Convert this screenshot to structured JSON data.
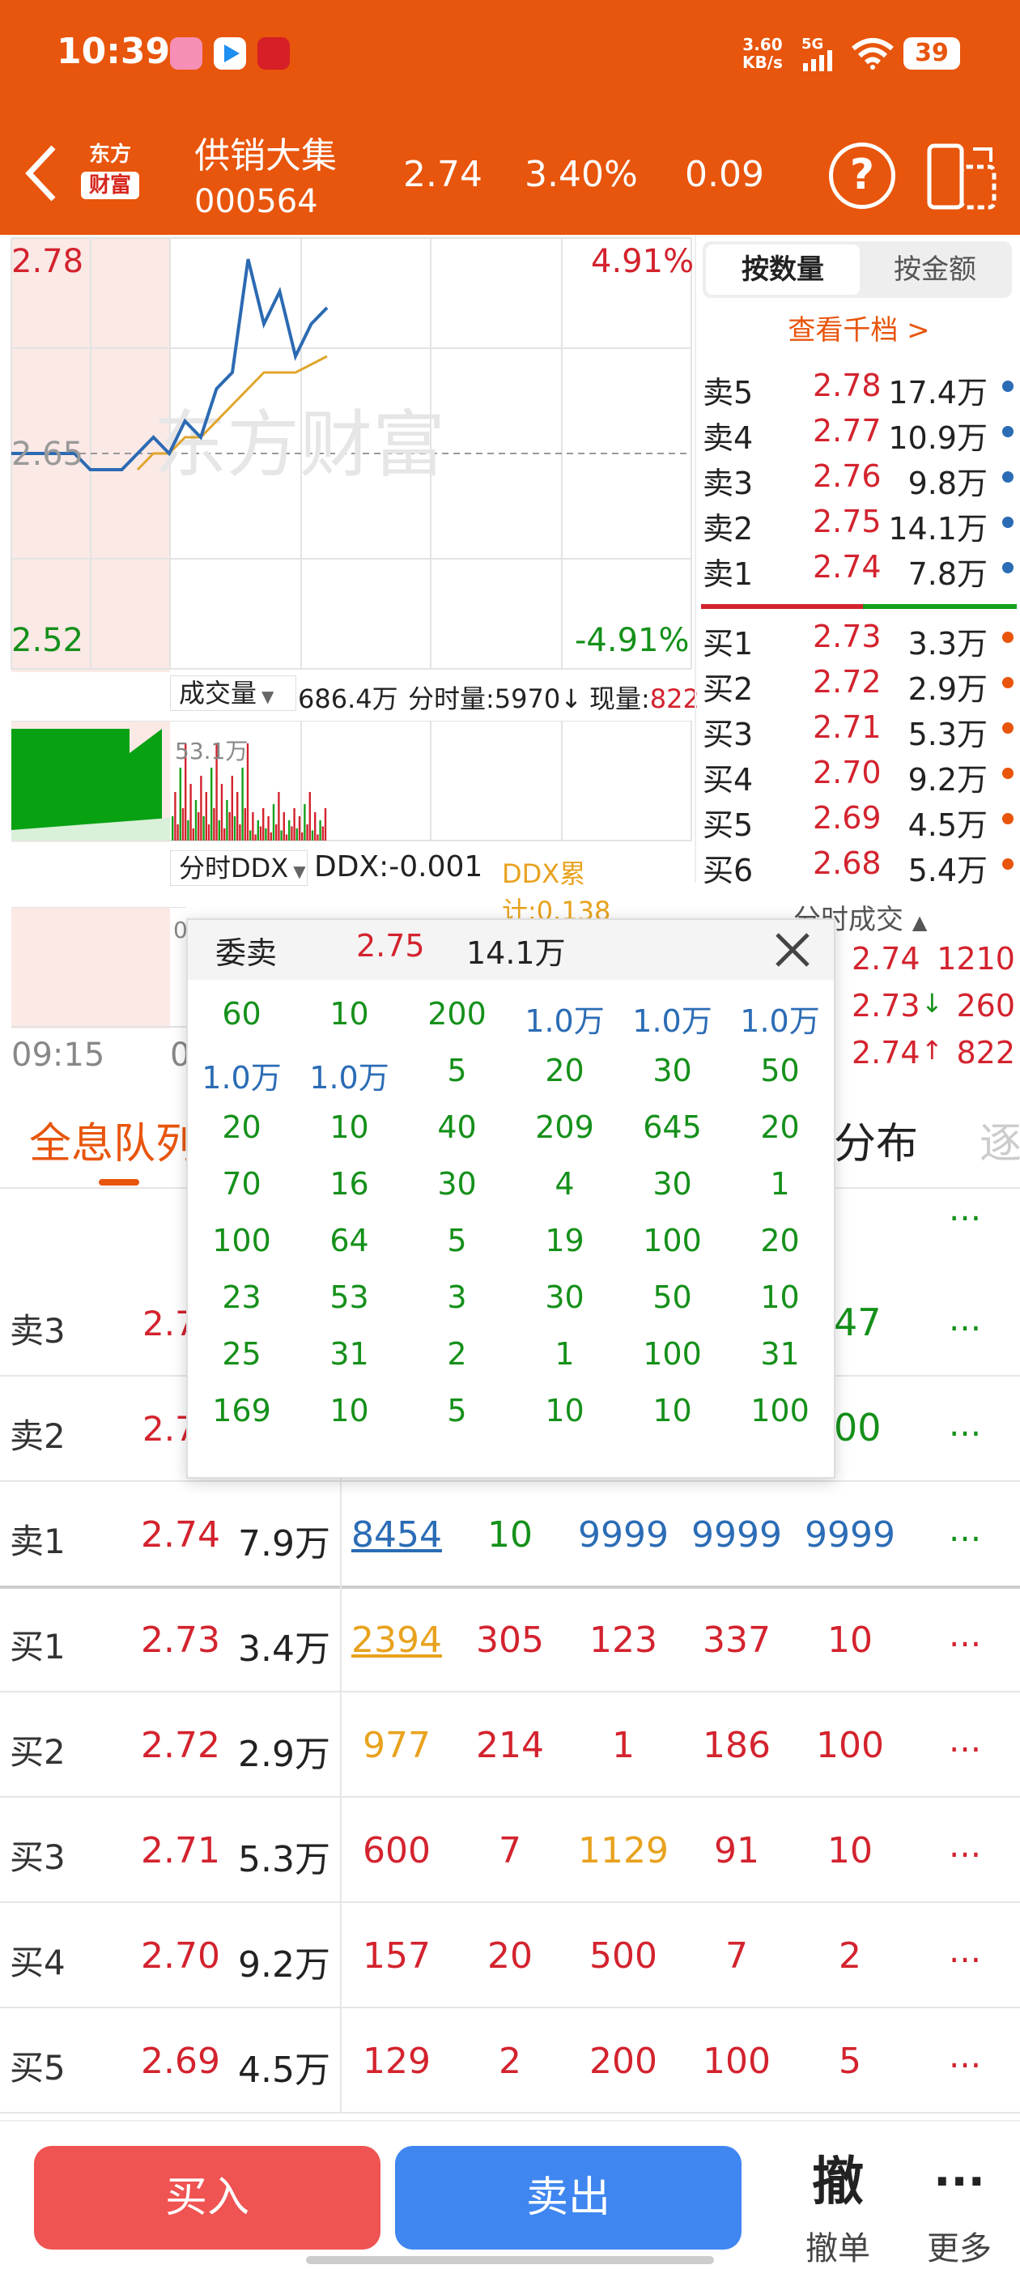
{
  "status": {
    "time": "10:39",
    "speed_value": "3.60",
    "speed_unit": "KB/s",
    "signal": "5G",
    "battery": "39"
  },
  "header": {
    "logo_line1": "东方",
    "logo_line2": "财富",
    "stock_name": "供销大集",
    "stock_code": "000564",
    "price": "2.74",
    "change_pct": "3.40%",
    "change": "0.09"
  },
  "chart": {
    "price_high": "2.78",
    "price_mid": "2.65",
    "price_low": "2.52",
    "pct_high": "4.91%",
    "pct_low": "-4.91%",
    "watermark": "东方财富",
    "volume_selector": "成交量",
    "volume_total": "686.4万",
    "fenshi_label": "分时量:5970",
    "xianliang_label": "现量:",
    "xianliang_value": "822",
    "vol_max": "53.1万",
    "ddx_selector": "分时DDX",
    "ddx_value": "DDX:-0.001",
    "ddx_total": "DDX累计:0.138",
    "time_start": "09:15",
    "time_partial": "0",
    "ddx_axis_partial": "0"
  },
  "chart_data": {
    "type": "line",
    "x": [
      0,
      1,
      2,
      3,
      4,
      5,
      6,
      7,
      8,
      9,
      10,
      11,
      12,
      13,
      14,
      15,
      16,
      17,
      18,
      19,
      20
    ],
    "series": [
      {
        "values": [
          2.65,
          2.65,
          2.65,
          2.65,
          2.65,
          2.64,
          2.64,
          2.64,
          2.65,
          2.66,
          2.65,
          2.67,
          2.66,
          2.69,
          2.7,
          2.77,
          2.73,
          2.75,
          2.71,
          2.73,
          2.74
        ]
      },
      {
        "values": [
          null,
          null,
          null,
          null,
          null,
          null,
          null,
          null,
          2.64,
          2.65,
          2.65,
          2.66,
          2.66,
          2.67,
          2.68,
          2.69,
          2.7,
          2.7,
          2.7,
          2.705,
          2.71
        ]
      }
    ],
    "ylim": [
      2.52,
      2.78
    ],
    "ref_line": 2.65
  },
  "order_book": {
    "tab_quantity": "按数量",
    "tab_amount": "按金额",
    "view_levels": "查看千档 >",
    "sells": [
      {
        "label": "卖5",
        "price": "2.78",
        "qty": "17.4万"
      },
      {
        "label": "卖4",
        "price": "2.77",
        "qty": "10.9万"
      },
      {
        "label": "卖3",
        "price": "2.76",
        "qty": "9.8万"
      },
      {
        "label": "卖2",
        "price": "2.75",
        "qty": "14.1万"
      },
      {
        "label": "卖1",
        "price": "2.74",
        "qty": "7.8万"
      }
    ],
    "buys": [
      {
        "label": "买1",
        "price": "2.73",
        "qty": "3.3万"
      },
      {
        "label": "买2",
        "price": "2.72",
        "qty": "2.9万"
      },
      {
        "label": "买3",
        "price": "2.71",
        "qty": "5.3万"
      },
      {
        "label": "买4",
        "price": "2.70",
        "qty": "9.2万"
      },
      {
        "label": "买5",
        "price": "2.69",
        "qty": "4.5万"
      },
      {
        "label": "买6",
        "price": "2.68",
        "qty": "5.4万"
      }
    ]
  },
  "trades": {
    "title": "分时成交",
    "rows": [
      {
        "price": "2.74",
        "vol": "1210",
        "arrow": ""
      },
      {
        "price": "2.73",
        "vol": "260",
        "arrow": "↓"
      },
      {
        "price": "2.74",
        "vol": "822",
        "arrow": "↑"
      }
    ]
  },
  "tabs": {
    "queue": "全息队列",
    "distribution": "分布",
    "partial": "逐"
  },
  "popup": {
    "title": "委卖",
    "price": "2.75",
    "qty": "14.1万",
    "rows": [
      [
        "60",
        "10",
        "200",
        "1.0万",
        "1.0万",
        "1.0万"
      ],
      [
        "1.0万",
        "1.0万",
        "5",
        "20",
        "30",
        "50"
      ],
      [
        "20",
        "10",
        "40",
        "209",
        "645",
        "20"
      ],
      [
        "70",
        "16",
        "30",
        "4",
        "30",
        "1"
      ],
      [
        "100",
        "64",
        "5",
        "19",
        "100",
        "20"
      ],
      [
        "23",
        "53",
        "3",
        "30",
        "50",
        "10"
      ],
      [
        "25",
        "31",
        "2",
        "1",
        "100",
        "31"
      ],
      [
        "169",
        "10",
        "5",
        "10",
        "10",
        "100"
      ]
    ]
  },
  "queue_table": {
    "partial_rows": [
      {
        "label": "卖3",
        "price": "2.7",
        "extra": "47"
      },
      {
        "label": "卖2",
        "price": "2.7",
        "extra": "00"
      }
    ],
    "rows": [
      {
        "label": "卖1",
        "price": "2.74",
        "qty": "7.9万",
        "o": [
          "8454",
          "10",
          "9999",
          "9999",
          "9999"
        ],
        "more": "..."
      },
      {
        "label": "买1",
        "price": "2.73",
        "qty": "3.4万",
        "o": [
          "2394",
          "305",
          "123",
          "337",
          "10"
        ],
        "more": "..."
      },
      {
        "label": "买2",
        "price": "2.72",
        "qty": "2.9万",
        "o": [
          "977",
          "214",
          "1",
          "186",
          "100"
        ],
        "more": "..."
      },
      {
        "label": "买3",
        "price": "2.71",
        "qty": "5.3万",
        "o": [
          "600",
          "7",
          "1129",
          "91",
          "10"
        ],
        "more": "..."
      },
      {
        "label": "买4",
        "price": "2.70",
        "qty": "9.2万",
        "o": [
          "157",
          "20",
          "500",
          "7",
          "2"
        ],
        "more": "..."
      },
      {
        "label": "买5",
        "price": "2.69",
        "qty": "4.5万",
        "o": [
          "129",
          "2",
          "200",
          "100",
          "5"
        ],
        "more": "..."
      }
    ],
    "more": "..."
  },
  "footer": {
    "buy": "买入",
    "sell": "卖出",
    "cancel_icon": "撤",
    "cancel": "撤单",
    "more": "更多"
  }
}
